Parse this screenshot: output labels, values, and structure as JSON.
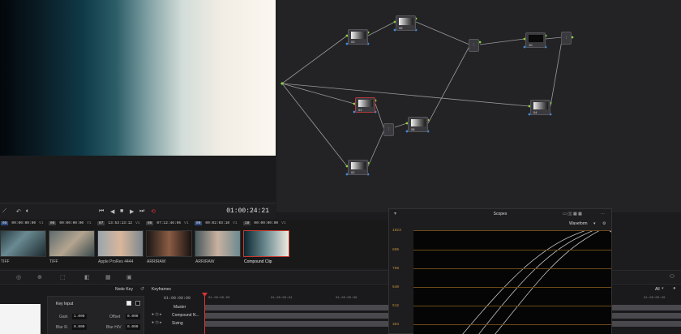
{
  "viewer": {
    "timecode": "01:00:24:21"
  },
  "node_graph": {
    "nodes": [
      {
        "id": "03"
      },
      {
        "id": "06"
      },
      {
        "id": "10"
      },
      {
        "id": "01"
      },
      {
        "id": "08"
      },
      {
        "id": "04"
      },
      {
        "id": "02"
      }
    ]
  },
  "clips": [
    {
      "num": "05",
      "timecode": "00:00:00:00",
      "track": "V1",
      "name": "TIFF"
    },
    {
      "num": "06",
      "timecode": "00:00:00:00",
      "track": "V1",
      "name": "TIFF"
    },
    {
      "num": "07",
      "timecode": "13:53:13:12",
      "track": "V1",
      "name": "Apple ProRes 4444"
    },
    {
      "num": "08",
      "timecode": "07:12:46:05",
      "track": "V1",
      "name": "ARRIRAW"
    },
    {
      "num": "09",
      "timecode": "00:02:03:10",
      "track": "V1",
      "name": "ARRIRAW"
    },
    {
      "num": "10",
      "timecode": "00:00:00:00",
      "track": "V1",
      "name": "Compound Clip"
    }
  ],
  "lower_panel": {
    "node_key_label": "Node Key",
    "keyframes_label": "Keyframes",
    "key_input": {
      "title": "Key Input",
      "gain_label": "Gain",
      "gain_value": "1.000",
      "offset_label": "Offset",
      "offset_value": "0.000",
      "blur_r_label": "Blur R.",
      "blur_r_value": "0.000",
      "blur_hv_label": "Blur H/V",
      "blur_hv_value": "0.000"
    },
    "keyframes": {
      "start_tc": "01:00:00:00",
      "ruler": [
        "01:00:00:00",
        "01:00:00:04",
        "01:00:00:08",
        "01:00:00:12",
        "01:00:00:20"
      ],
      "rows": [
        "Master",
        "Compound N...",
        "Sizing"
      ],
      "filter": "All"
    }
  },
  "scopes": {
    "title": "Scopes",
    "mode": "Waveform",
    "scale": [
      "1023",
      "896",
      "768",
      "640",
      "512",
      "384"
    ]
  }
}
